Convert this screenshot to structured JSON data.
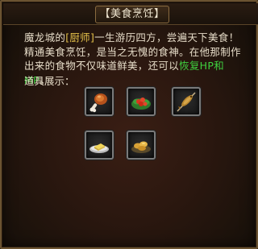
{
  "window": {
    "title": "【美食烹饪】"
  },
  "description": {
    "seg1": "魔龙城的",
    "seg2": "[厨师]",
    "seg3": "一生游历四方，尝遍天下美食！精通美食烹饪，是当之无愧的食神。在他那制作出来的食物不仅味道鲜美，还可以",
    "seg4": "恢复HP和MP",
    "seg5": "。"
  },
  "items_label": "道具展示：",
  "items": [
    {
      "icon": "roast-drumstick-icon"
    },
    {
      "icon": "vegetable-dish-icon"
    },
    {
      "icon": "grilled-fish-icon"
    },
    {
      "icon": "tofu-plate-icon"
    },
    {
      "icon": "fried-dumplings-icon"
    }
  ],
  "colors": {
    "highlight_yellow": "#e3c04a",
    "highlight_green": "#3fd13f",
    "text": "#e6dcc8",
    "border": "#6b5331"
  }
}
